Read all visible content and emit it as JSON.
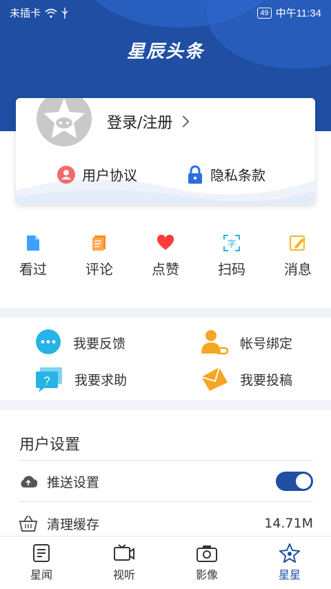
{
  "status_bar": {
    "carrier": "未插卡",
    "battery": "49",
    "time": "中午11:34"
  },
  "header": {
    "logo_text": "星辰头条"
  },
  "profile_card": {
    "login_label": "登录/注册",
    "user_agreement": "用户协议",
    "privacy_policy": "隐私条款"
  },
  "quick_actions": [
    {
      "label": "看过",
      "icon": "document-icon",
      "color": "#3ea1ff"
    },
    {
      "label": "评论",
      "icon": "comment-icon",
      "color": "#ff8a1f"
    },
    {
      "label": "点赞",
      "icon": "heart-icon",
      "color": "#ff3b3b"
    },
    {
      "label": "扫码",
      "icon": "scan-icon",
      "color": "#26b3e6"
    },
    {
      "label": "消息",
      "icon": "message-icon",
      "color": "#f5b623"
    }
  ],
  "services": {
    "feedback": "我要反馈",
    "account_binding": "帐号绑定",
    "help": "我要求助",
    "submit": "我要投稿"
  },
  "settings": {
    "title": "用户设置",
    "push": "推送设置",
    "push_enabled": true,
    "cache": "清理缓存",
    "cache_size": "14.71M"
  },
  "tabs": [
    {
      "label": "星闻",
      "icon": "news-icon",
      "active": false
    },
    {
      "label": "视听",
      "icon": "video-icon",
      "active": false
    },
    {
      "label": "影像",
      "icon": "camera-icon",
      "active": false
    },
    {
      "label": "星星",
      "icon": "star-icon",
      "active": true
    }
  ],
  "colors": {
    "brand": "#1f4ea3",
    "accent": "#26b3e6"
  }
}
